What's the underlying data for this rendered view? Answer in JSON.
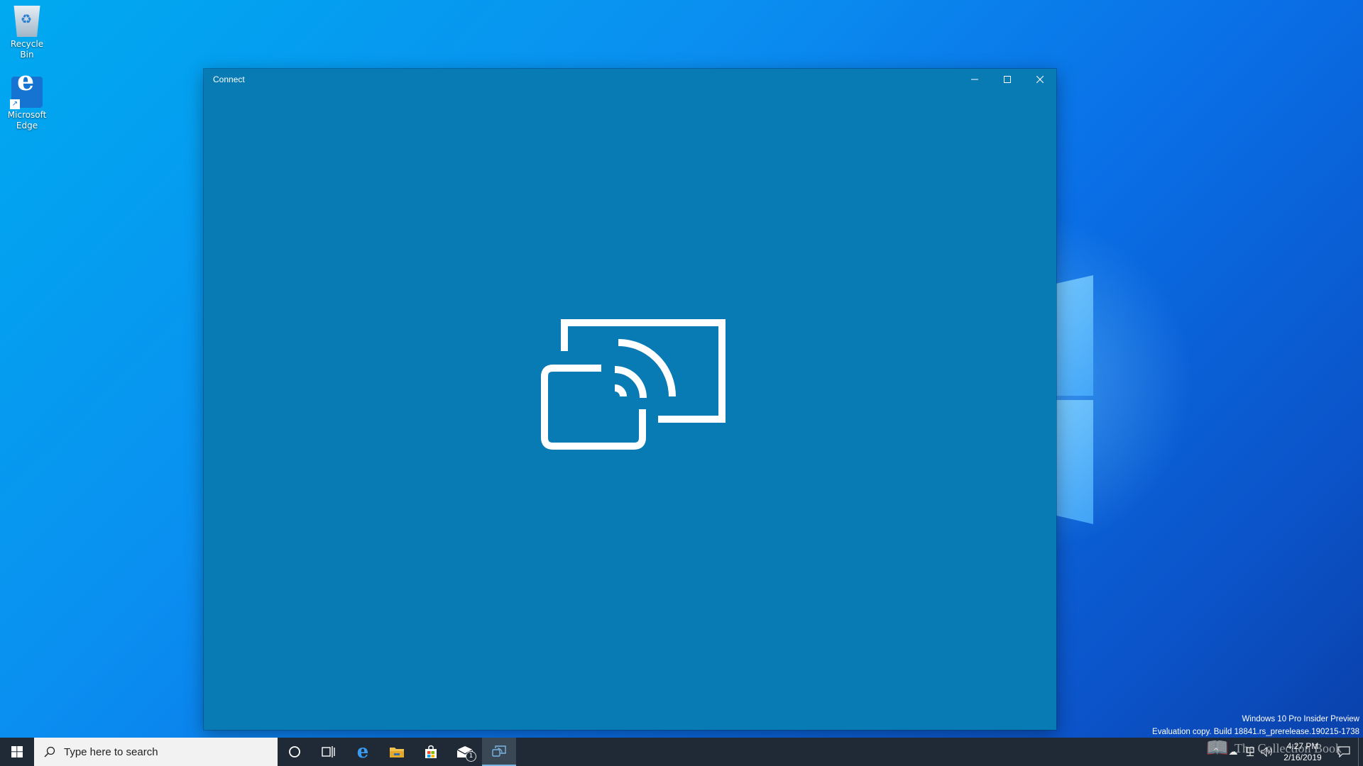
{
  "desktop": {
    "icons": [
      {
        "label": "Recycle Bin",
        "icon": "recycle-bin-icon"
      },
      {
        "label": "Microsoft Edge",
        "icon": "edge-icon"
      }
    ]
  },
  "window": {
    "title": "Connect",
    "accent": "#087bb4",
    "graphic": "wireless-display-cast-icon"
  },
  "watermark": {
    "line1": "Windows 10 Pro Insider Preview",
    "line2": "Evaluation copy. Build 18841.rs_prerelease.190215-1738"
  },
  "taskbar": {
    "search_placeholder": "Type here to search",
    "pinned": [
      "cortana-icon",
      "task-view-icon",
      "edge-icon",
      "file-explorer-icon",
      "store-icon",
      "mail-icon",
      "connect-icon"
    ],
    "mail_badge": "1",
    "clock_time": "4:27 PM",
    "clock_date": "2/16/2019",
    "overlay_text": "The Collection Book"
  }
}
